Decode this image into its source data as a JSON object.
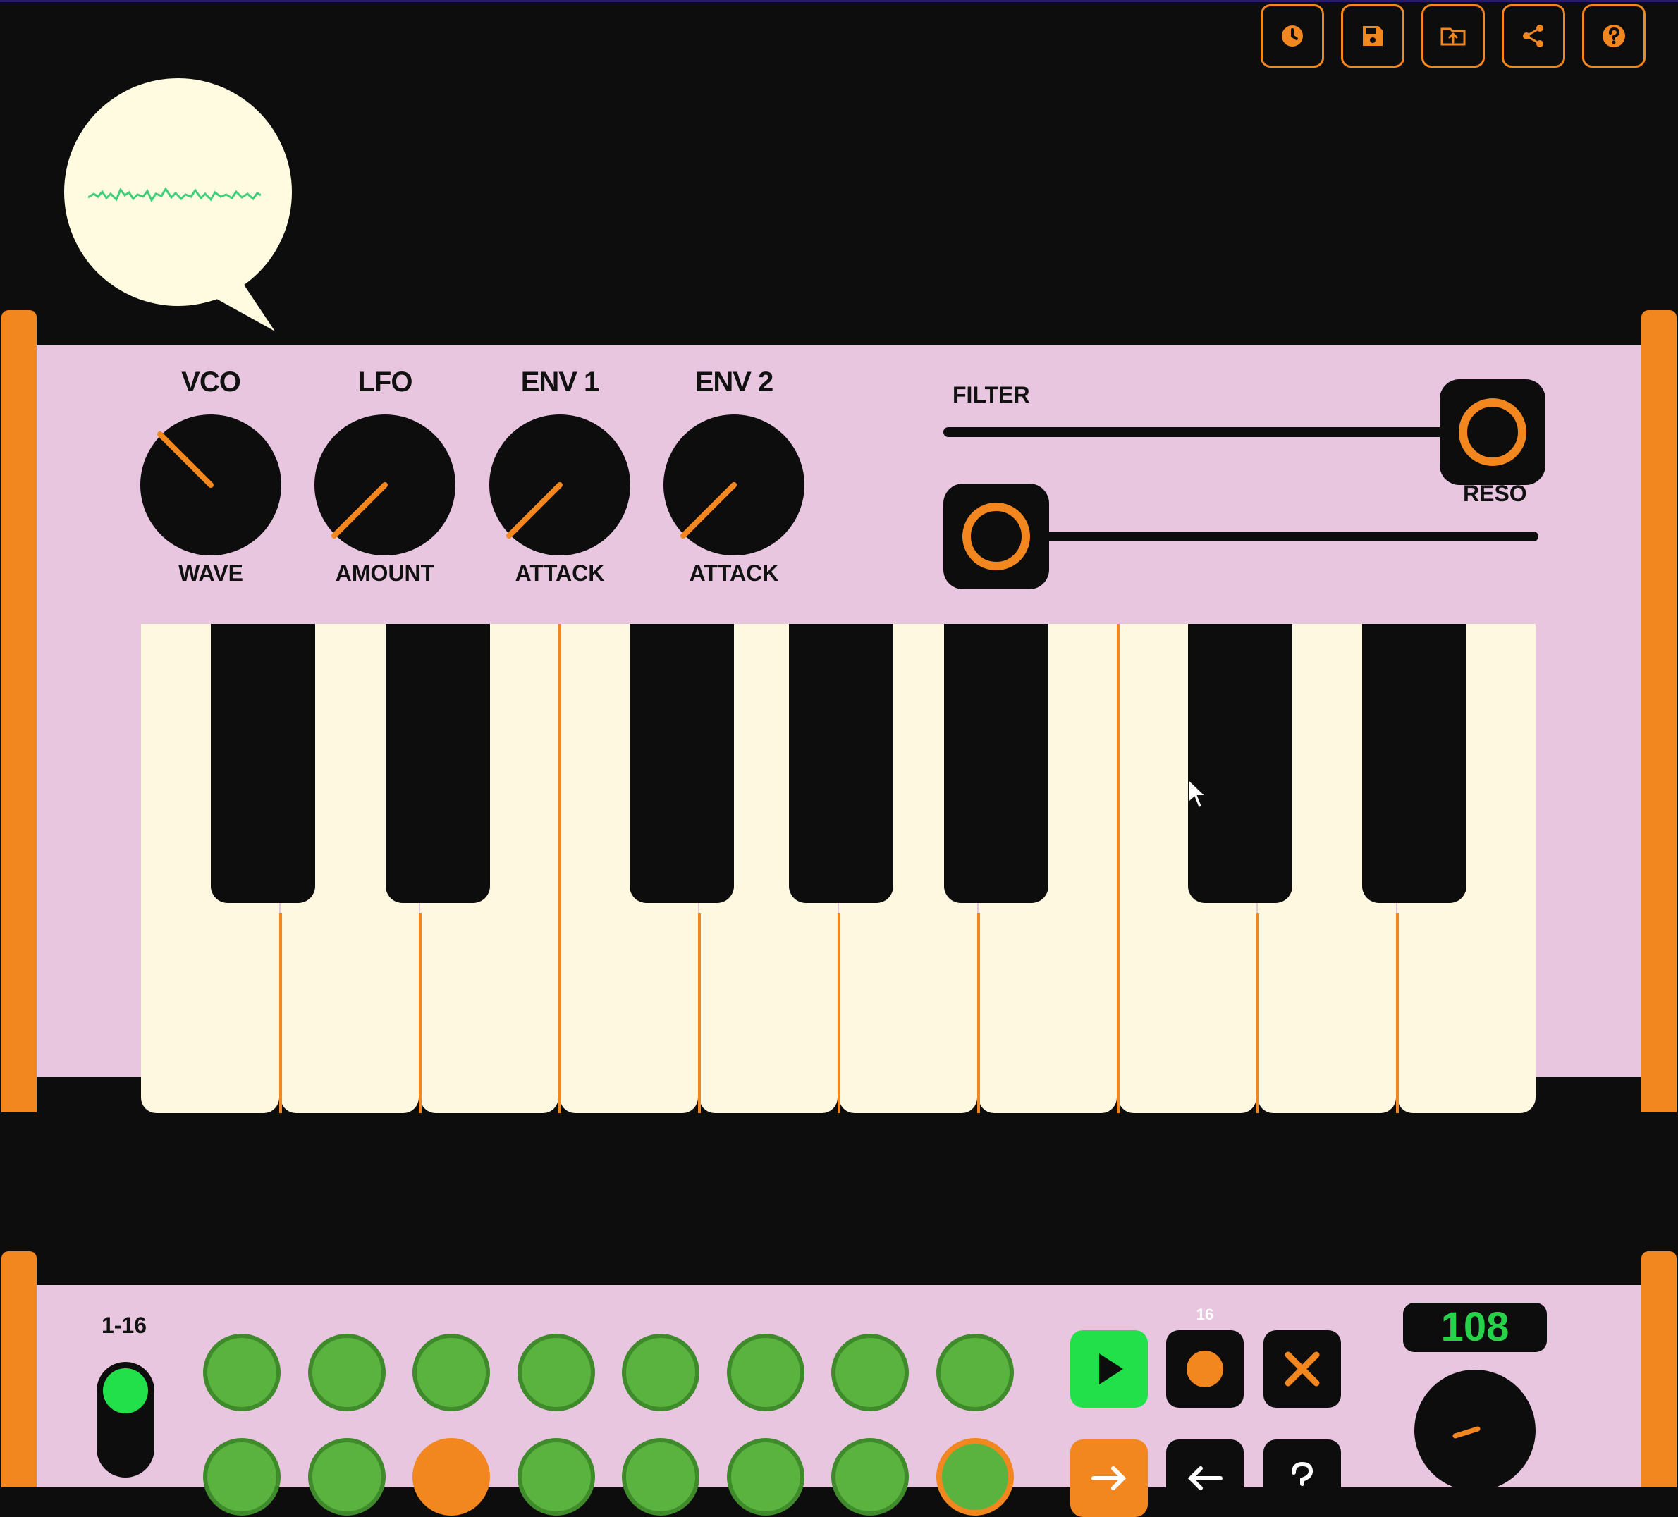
{
  "toolbar": {
    "buttons": [
      {
        "name": "history",
        "icon": "clock-icon"
      },
      {
        "name": "save",
        "icon": "save-icon"
      },
      {
        "name": "load",
        "icon": "folder-upload-icon"
      },
      {
        "name": "share",
        "icon": "share-icon"
      },
      {
        "name": "help",
        "icon": "help-icon"
      }
    ]
  },
  "synth": {
    "knobs": [
      {
        "title": "VCO",
        "param": "WAVE"
      },
      {
        "title": "LFO",
        "param": "AMOUNT"
      },
      {
        "title": "ENV 1",
        "param": "ATTACK"
      },
      {
        "title": "ENV 2",
        "param": "ATTACK"
      }
    ],
    "filter": {
      "label": "FILTER",
      "value": 1.0
    },
    "reso": {
      "label": "RESO",
      "value": 0.0
    }
  },
  "sequencer": {
    "range_label": "1-16",
    "step_count_label": "16",
    "tempo": "108"
  },
  "colors": {
    "accent": "#f2861f",
    "panel": "#e8c6e0",
    "step_green": "#5ab33e",
    "play_green": "#22e04a",
    "tempo_green": "#26d24a",
    "background": "#0e0d0e",
    "key_white": "#fff8e1"
  }
}
